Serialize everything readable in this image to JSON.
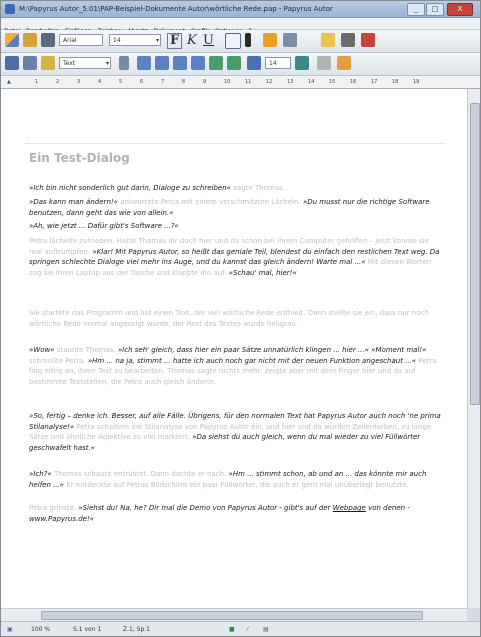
{
  "window": {
    "title": "M:\\Papyrus Autor_5.01\\PAP-Beispiel-Dokumente Autor\\wörtliche Rede.pap - Papyrus Autor",
    "minimize": "_",
    "maximize": "□",
    "close": "X"
  },
  "menubar": {
    "items": [
      "Datei",
      "Bearbeiten",
      "Einfügen",
      "Zeichen",
      "Absatz",
      "Dokument",
      "Grafik",
      "Optionen",
      "?"
    ]
  },
  "toolbar": {
    "font_name": "Arial",
    "font_size": "14",
    "bold": "F",
    "italic": "K",
    "underline": "U",
    "style": "Text",
    "spacing": "14"
  },
  "ruler": {
    "marks": [
      "1",
      "2",
      "3",
      "4",
      "5",
      "6",
      "7",
      "8",
      "9",
      "10",
      "11",
      "12",
      "13",
      "14",
      "15",
      "16",
      "17",
      "18",
      "19"
    ]
  },
  "document": {
    "title": "Ein Test-Dialog",
    "paragraphs": [
      [
        {
          "t": "»Ich bin nicht sonderlich gut darin, Dialoge zu schreiben«",
          "q": true
        },
        {
          "t": " sagte Thomas.",
          "q": false
        }
      ],
      [
        {
          "t": "»Das kann man ändern!«",
          "q": true
        },
        {
          "t": " antwortete Petra mit einem verschmitzten Lächeln. ",
          "q": false
        },
        {
          "t": "»Du musst nur die richtige Software benutzen, dann geht das wie von allein.«",
          "q": true
        }
      ],
      [
        {
          "t": "»Ah, wie jetzt ... Dafür gibt's Software ...?«",
          "q": true
        }
      ],
      [
        {
          "t": "Petra lächelte zufrieden. Hatte Thomas ihr doch hier und da schon bei ihrem Computer geholfen – jetzt konnte sie mal auftrumpfen. ",
          "q": false
        },
        {
          "t": "»Klar! Mit Papyrus Autor, so heißt das geniale Teil, blendest du einfach den restlichen Text weg. Da springen schlechte Dialoge viel mehr ins Auge, und du kannst das gleich ändern! Warte mal ...«",
          "q": true
        },
        {
          "t": " Mit diesen Worten zog sie ihren Laptop aus der Tasche und klappte ihn auf. ",
          "q": false
        },
        {
          "t": "»Schau' mal, hier!«",
          "q": true
        }
      ],
      [
        {
          "t": "Sie startete das Programm und lud einen Text, der viel wörtliche Rede enthielt. Dann stellte sie ein, dass nur noch wörtliche Rede normal angezeigt wurde, der Rest des Textes wurde heligrau.",
          "q": false
        }
      ],
      [
        {
          "t": "»Wow«",
          "q": true
        },
        {
          "t": " staunte Thomas. ",
          "q": false
        },
        {
          "t": "»Ich seh' gleich, dass hier ein paar Sätze unnatürlich klingen ... hier ...« »Moment mal!«",
          "q": true
        },
        {
          "t": " schmollte Petra. ",
          "q": false
        },
        {
          "t": "»Hm ... na ja, stimmt ... hatte ich auch noch gar nicht mit der neuen Funktion angeschaut ...«",
          "q": true
        },
        {
          "t": " Petra fing eifrig an, ihren Text zu bearbeiten. Thomas sagte nichts mehr, zeigte aber mit dem Finger hier und da auf bestimmte Textstellen, die Petra auch gleich änderte.",
          "q": false
        }
      ],
      [
        {
          "t": "»So, fertig – denke ich. Besser, auf alle Fälle. Übrigens, für den normalen Text hat Papyrus Autor auch noch 'ne prima Stilanalyse!«",
          "q": true
        },
        {
          "t": " Petra schaltete die Stilanalyse von Papyrus Autor ein, und hier und da wurden Zeilenfarben, zu lange Sätze und ähnliche Adjektive zu viel markiert. ",
          "q": false
        },
        {
          "t": "»Da siehst du auch gleich, wenn du mal wieder zu viel Füllwörter geschwafelt hast.«",
          "q": true
        }
      ],
      [
        {
          "t": "»Ich?«",
          "q": true
        },
        {
          "t": " Thomas schaute entrüstet. Dann dachte er nach. ",
          "q": false
        },
        {
          "t": "»Hm ... stimmt schon, ab und an ... das könnte mir auch helfen ...«",
          "q": true
        },
        {
          "t": " Er entdeckte auf Petras Bildschirm ein paar Füllwörter, die auch er gern mal unüberlegt benutzte.",
          "q": false
        }
      ],
      [
        {
          "t": "Petra grinste. ",
          "q": false
        },
        {
          "t": "»Siehst du! Na, he? Dir mal die Demo von Papyrus Autor - gibt's auf der ",
          "q": true
        },
        {
          "t": "Webpage",
          "q": true,
          "link": true
        },
        {
          "t": " von denen - www.Papyrus.de!«",
          "q": true
        }
      ]
    ]
  },
  "status": {
    "zoom": "100 %",
    "page": "S.1 von 1",
    "position": "Z.1, Sp.1"
  },
  "colors": {
    "quote_text": "#1a1a1a",
    "dimmed_text": "#c0c0c0",
    "title_bar": "#9db3d6"
  }
}
